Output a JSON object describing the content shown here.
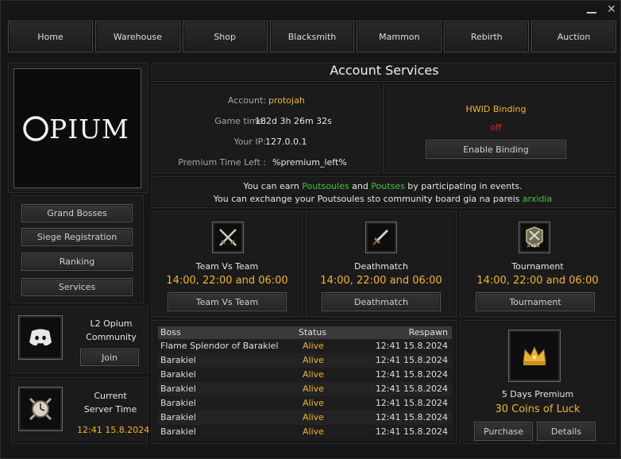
{
  "nav": [
    "Home",
    "Warehouse",
    "Shop",
    "Blacksmith",
    "Mammon",
    "Rebirth",
    "Auction"
  ],
  "logo": {
    "text": "OPIUM"
  },
  "sidebar": {
    "links": [
      "Grand Bosses",
      "Siege Registration",
      "Ranking",
      "Services"
    ]
  },
  "discord": {
    "title_line1": "L2 Opium",
    "title_line2": "Community",
    "join_label": "Join",
    "icon": "discord-icon"
  },
  "server_time": {
    "label_line1": "Current",
    "label_line2": "Server Time",
    "value": "12:41 15.8.2024",
    "icon": "clock-icon"
  },
  "account": {
    "title": "Account Services",
    "account_label": "Account:",
    "account_value": "protojah",
    "gametime_label": "Game time:",
    "gametime_value": "182d 3h 26m 32s",
    "ip_label": "Your IP:",
    "ip_value": "127.0.0.1",
    "premium_label": "Premium Time Left :",
    "premium_value": "%premium_left%"
  },
  "hwid": {
    "title": "HWID Binding",
    "status": "off",
    "button": "Enable Binding"
  },
  "notice": {
    "l1_a": "You can earn ",
    "l1_b": "Poutsoules",
    "l1_c": " and ",
    "l1_d": "Poutses",
    "l1_e": " by participating in events.",
    "l2_a": "You can exchange your Poutsoules sto community board gia na pareis ",
    "l2_b": "arxidia"
  },
  "events": [
    {
      "name": "Team Vs Team",
      "times": "14:00, 22:00 and 06:00",
      "button": "Team Vs Team",
      "icon": "crossed-swords-icon"
    },
    {
      "name": "Deathmatch",
      "times": "14:00, 22:00 and 06:00",
      "button": "Deathmatch",
      "icon": "sword-icon"
    },
    {
      "name": "Tournament",
      "times": "14:00, 22:00 and 06:00",
      "button": "Tournament",
      "icon": "tournament-3vs3-icon",
      "icon_text": "3vs3"
    }
  ],
  "bosses": {
    "headers": [
      "Boss",
      "Status",
      "Respawn"
    ],
    "rows": [
      [
        "Flame Splendor of Barakiel",
        "Alive",
        "12:41 15.8.2024"
      ],
      [
        "Barakiel",
        "Alive",
        "12:41 15.8.2024"
      ],
      [
        "Barakiel",
        "Alive",
        "12:41 15.8.2024"
      ],
      [
        "Barakiel",
        "Alive",
        "12:41 15.8.2024"
      ],
      [
        "Barakiel",
        "Alive",
        "12:41 15.8.2024"
      ],
      [
        "Barakiel",
        "Alive",
        "12:41 15.8.2024"
      ],
      [
        "Barakiel",
        "Alive",
        "12:41 15.8.2024"
      ]
    ]
  },
  "premium": {
    "title": "5 Days Premium",
    "price": "30 Coins of Luck",
    "purchase": "Purchase",
    "details": "Details",
    "icon": "crown-icon"
  },
  "colors": {
    "accent_orange": "#f2b527",
    "green": "#3fc43c",
    "red": "#e02a1f"
  }
}
